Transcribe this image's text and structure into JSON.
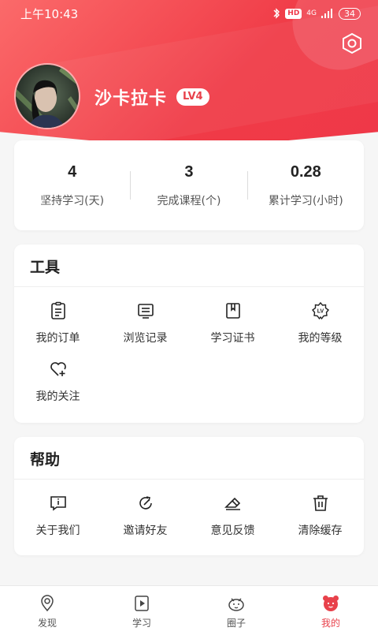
{
  "status_bar": {
    "time": "上午10:43",
    "network": "4G",
    "battery": "34"
  },
  "profile": {
    "username": "沙卡拉卡",
    "level": "LV4"
  },
  "stats": [
    {
      "value": "4",
      "label": "坚持学习(天)"
    },
    {
      "value": "3",
      "label": "完成课程(个)"
    },
    {
      "value": "0.28",
      "label": "累计学习(小时)"
    }
  ],
  "tools": {
    "title": "工具",
    "items": [
      {
        "label": "我的订单",
        "icon": "order-icon"
      },
      {
        "label": "浏览记录",
        "icon": "history-icon"
      },
      {
        "label": "学习证书",
        "icon": "certificate-icon"
      },
      {
        "label": "我的等级",
        "icon": "level-icon"
      },
      {
        "label": "我的关注",
        "icon": "heart-plus-icon"
      }
    ]
  },
  "help": {
    "title": "帮助",
    "items": [
      {
        "label": "关于我们",
        "icon": "info-icon"
      },
      {
        "label": "邀请好友",
        "icon": "invite-icon"
      },
      {
        "label": "意见反馈",
        "icon": "feedback-icon"
      },
      {
        "label": "清除缓存",
        "icon": "trash-icon"
      }
    ]
  },
  "tabbar": {
    "items": [
      {
        "label": "发现",
        "icon": "discover-icon",
        "active": false
      },
      {
        "label": "学习",
        "icon": "study-icon",
        "active": false
      },
      {
        "label": "圈子",
        "icon": "circle-icon",
        "active": false
      },
      {
        "label": "我的",
        "icon": "mine-icon",
        "active": true
      }
    ]
  },
  "colors": {
    "accent": "#ef3848",
    "background": "#f6f6f6"
  }
}
